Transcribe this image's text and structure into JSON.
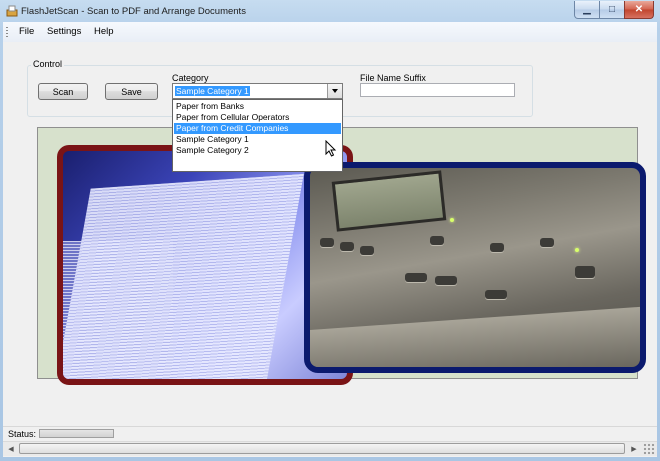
{
  "window": {
    "title": "FlashJetScan - Scan to PDF and Arrange Documents",
    "minimize_icon": "minimize-icon",
    "maximize_icon": "maximize-icon",
    "close_icon": "close-icon"
  },
  "menu": {
    "items": [
      "File",
      "Settings",
      "Help"
    ]
  },
  "control": {
    "legend": "Control",
    "scan_label": "Scan",
    "save_label": "Save",
    "category_label": "Category",
    "category_selected": "Sample Category 1",
    "category_options": [
      "Paper from Banks",
      "Paper from Cellular Operators",
      "Paper from Credit Companies",
      "Sample Category 1",
      "Sample Category 2"
    ],
    "highlighted_option": "Paper from Credit Companies",
    "file_name_suffix_label": "File Name Suffix",
    "file_name_suffix_value": ""
  },
  "status": {
    "label": "Status:",
    "progress": 0
  },
  "colors": {
    "selection": "#3399ff",
    "paper_frame": "#7a1416",
    "scanner_frame": "#0b1a6e",
    "panel_background": "#d7e1cc"
  }
}
